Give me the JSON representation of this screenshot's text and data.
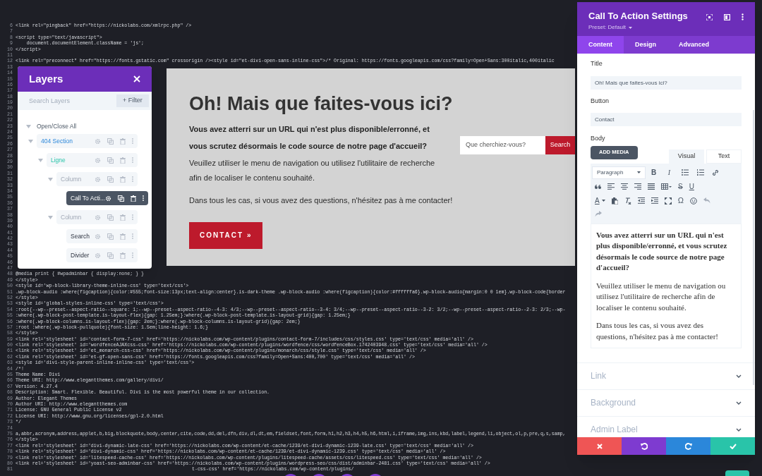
{
  "code_editor": {
    "lines": [
      {
        "number": "6",
        "code": "<link rel=\"pingback\" href=\"https://nickolabs.com/xmlrpc.php\" />"
      },
      {
        "number": "7"
      },
      {
        "number": "8",
        "code": "<script type=\"text/javascript\">"
      },
      {
        "number": "9",
        "code": "    document.documentElement.className = 'js';"
      },
      {
        "number": "10",
        "code": "</script>"
      },
      {
        "number": "11"
      },
      {
        "number": "12",
        "code": "<link rel=\"preconnect\" href=\"https://fonts.gstatic.com\" crossorigin /><style id=\"et-divi-open-sans-inline-css\">/* Original: https://fonts.googleapis.com/css?family=Open+Sans:300italic,400italic"
      },
      {
        "number": "13"
      },
      {
        "number": "14"
      },
      {
        "number": "15"
      },
      {
        "number": "16"
      },
      {
        "number": "17"
      },
      {
        "number": "18"
      },
      {
        "number": "19"
      },
      {
        "number": "20"
      },
      {
        "number": "21"
      },
      {
        "number": "22"
      },
      {
        "number": "23"
      },
      {
        "number": "24"
      },
      {
        "number": "25"
      },
      {
        "number": "26"
      },
      {
        "number": "27"
      },
      {
        "number": "28"
      },
      {
        "number": "29"
      },
      {
        "number": "30"
      },
      {
        "number": "31"
      },
      {
        "number": "32"
      },
      {
        "number": "33"
      },
      {
        "number": "34"
      },
      {
        "number": "35"
      },
      {
        "number": "36"
      },
      {
        "number": "37"
      },
      {
        "number": "38"
      },
      {
        "number": "39"
      },
      {
        "number": "40"
      },
      {
        "number": "41"
      },
      {
        "number": "42"
      },
      {
        "number": "43"
      },
      {
        "number": "44"
      },
      {
        "number": "45"
      },
      {
        "number": "46"
      },
      {
        "number": "47"
      },
      {
        "number": "48",
        "code": "@media print { #wpadminbar { display:none; } }"
      },
      {
        "number": "49",
        "code": "</style>"
      },
      {
        "number": "50",
        "code": "<style id='wp-block-library-theme-inline-css' type='text/css'>"
      },
      {
        "number": "51",
        "code": ".wp-block-audio :where(figcaption){color:#555;font-size:13px;text-align:center}.is-dark-theme .wp-block-audio :where(figcaption){color:#ffffffa6}.wp-block-audio{margin:0 0 1em}.wp-block-code{border"
      },
      {
        "number": "52",
        "code": "</style>"
      },
      {
        "number": "53",
        "code": "<style id='global-styles-inline-css' type='text/css'>"
      },
      {
        "number": "54",
        "code": ":root{--wp--preset--aspect-ratio--square: 1;--wp--preset--aspect-ratio--4-3: 4/3;--wp--preset--aspect-ratio--3-4: 3/4;--wp--preset--aspect-ratio--3-2: 3/2;--wp--preset--aspect-ratio--2-3: 2/3;--wp-"
      },
      {
        "number": "55",
        "code": ":where(.wp-block-post-template.is-layout-flex){gap: 1.25em;}:where(.wp-block-post-template.is-layout-grid){gap: 1.25em;}"
      },
      {
        "number": "56",
        "code": ":where(.wp-block-columns.is-layout-flex){gap: 2em;}:where(.wp-block-columns.is-layout-grid){gap: 2em;}"
      },
      {
        "number": "57",
        "code": ":root :where(.wp-block-pullquote){font-size: 1.5em;line-height: 1.6;}"
      },
      {
        "number": "58",
        "code": "</style>"
      },
      {
        "number": "59",
        "code": "<link rel='stylesheet' id='contact-form-7-css' href='https://nickolabs.com/wp-content/plugins/contact-form-7/includes/css/styles.css' type='text/css' media='all' />"
      },
      {
        "number": "60",
        "code": "<link rel='stylesheet' id='wordfenceAJAXcss-css' href='https://nickolabs.com/wp-content/plugins/wordfence/css/wordfenceBox.1742403948.css' type='text/css' media='all' />"
      },
      {
        "number": "61",
        "code": "<link rel='stylesheet' id='et_monarch-css-css' href='https://nickolabs.com/wp-content/plugins/monarch/css/style.css' type='text/css' media='all' />"
      },
      {
        "number": "62",
        "code": "<link rel='stylesheet' id='et-gf-open-sans-css' href='https://fonts.googleapis.com/css?family=Open+Sans:400,700' type='text/css' media='all' />"
      },
      {
        "number": "63",
        "code": "<style id='divi-style-parent-inline-inline-css' type='text/css'>"
      },
      {
        "number": "64",
        "code": "/*!"
      },
      {
        "number": "65",
        "code": "Theme Name: Divi"
      },
      {
        "number": "66",
        "code": "Theme URI: http://www.elegantthemes.com/gallery/divi/"
      },
      {
        "number": "67",
        "code": "Version: 4.27.4"
      },
      {
        "number": "68",
        "code": "Description: Smart. Flexible. Beautiful. Divi is the most powerful theme in our collection."
      },
      {
        "number": "69",
        "code": "Author: Elegant Themes"
      },
      {
        "number": "70",
        "code": "Author URI: http://www.elegantthemes.com"
      },
      {
        "number": "71",
        "code": "License: GNU General Public License v2"
      },
      {
        "number": "72",
        "code": "License URI: http://www.gnu.org/licenses/gpl-2.0.html"
      },
      {
        "number": "73",
        "code": "*/"
      },
      {
        "number": "74"
      },
      {
        "number": "75",
        "code": "a,abbr,acronym,address,applet,b,big,blockquote,body,center,cite,code,dd,del,dfn,div,dl,dt,em,fieldset,font,form,h1,h2,h3,h4,h5,h6,html,i,iframe,img,ins,kbd,label,legend,li,object,ol,p,pre,q,s,samp,"
      },
      {
        "number": "76",
        "code": "</style>"
      },
      {
        "number": "77",
        "code": "<link rel='stylesheet' id='divi-dynamic-late-css' href='https://nickolabs.com/wp-content/et-cache/1239/et-divi-dynamic-1239-late.css' type='text/css' media='all' />"
      },
      {
        "number": "78",
        "code": "<link rel='stylesheet' id='divi-dynamic-css' href='https://nickolabs.com/wp-content/et-cache/1239/et-divi-dynamic-1239.css' type='text/css' media='all' />"
      },
      {
        "number": "79",
        "code": "<link rel='stylesheet' id='litespeed-cache-css' href='https://nickolabs.com/wp-content/plugins/litespeed-cache/assets/css/litespeed.css' type='text/css' media='all' />"
      },
      {
        "number": "80",
        "code": "<link rel='stylesheet' id='yoast-seo-adminbar-css' href='https://nickolabs.com/wp-content/plugins/wordpress-seo/css/dist/adminbar-2481.css' type='text/css' media='all' />"
      },
      {
        "number": "81",
        "code": "t-css-css' href='https://nickolabs.com/wp-content/plugins/"
      }
    ]
  },
  "layers": {
    "title": "Layers",
    "search": {
      "placeholder": "Search Layers"
    },
    "filter_button": "+ Filter",
    "open_close_all": "Open/Close All",
    "tree": [
      {
        "kind": "section",
        "label": "404 Section",
        "selected": false,
        "expanded": true,
        "children": [
          {
            "kind": "row",
            "label": "Ligne",
            "selected": false,
            "expanded": true,
            "children": [
              {
                "kind": "column",
                "label": "Column",
                "selected": false,
                "expanded": true,
                "children": [
                  {
                    "kind": "module",
                    "label": "Call To Acti...",
                    "selected": true
                  }
                ]
              },
              {
                "kind": "column",
                "label": "Column",
                "selected": false,
                "expanded": true,
                "children": [
                  {
                    "kind": "module",
                    "label": "Search",
                    "selected": false
                  },
                  {
                    "kind": "module",
                    "label": "Divider",
                    "selected": false
                  }
                ]
              }
            ]
          }
        ]
      }
    ]
  },
  "section": {
    "title": "Oh! Mais que faites-vous ici?",
    "lead": "Vous avez atterri sur un URL qui n'est plus disponible/erronné, et vous scrutez désormais le code source de notre page d'accueil?",
    "paragraphs": [
      "Veuillez utiliser le menu de navigation ou utilisez l'utilitaire de recherche afin de localiser le contenu souhaité.",
      "Dans tous les cas, si vous avez des questions, n'hésitez pas à me contacter!"
    ],
    "button": "CONTACT »",
    "search": {
      "placeholder": "Que cherchiez-vous?",
      "button": "Search"
    }
  },
  "settings": {
    "title": "Call To Action Settings",
    "preset": "Preset: Default",
    "tabs": [
      {
        "label": "Content",
        "selected": true
      },
      {
        "label": "Design",
        "selected": false
      },
      {
        "label": "Advanced",
        "selected": false
      }
    ],
    "fields": [
      {
        "label": "Title",
        "value": "Oh! Mais que faites-vous ici?"
      },
      {
        "label": "Button",
        "value": "Contact"
      }
    ],
    "body": {
      "label": "Body",
      "add_media": "ADD MEDIA",
      "editor_tabs": [
        {
          "label": "Visual",
          "selected": true
        },
        {
          "label": "Text",
          "selected": false
        }
      ],
      "toolbar": {
        "format": "Paragraph",
        "bold": "B",
        "italic": "I",
        "strike": "S",
        "underline": "U",
        "text_color": "A",
        "special_char": "Ω"
      },
      "content": [
        {
          "text": "Vous avez atterri sur un URL qui n'est plus disponible/erronné, et vous scrutez désormais le code source de notre page d'accueil?",
          "bold": true
        },
        {
          "text": "Veuillez utiliser le menu de navigation ou utilisez l'utilitaire de recherche afin de localiser le contenu souhaité.",
          "bold": false
        },
        {
          "text": "Dans tous les cas, si vous avez des questions, n'hésitez pas à me contacter!",
          "bold": false
        }
      ]
    },
    "toggles": [
      {
        "label": "Link",
        "expanded": false
      },
      {
        "label": "Background",
        "expanded": false
      },
      {
        "label": "Admin Label",
        "expanded": false
      }
    ]
  }
}
